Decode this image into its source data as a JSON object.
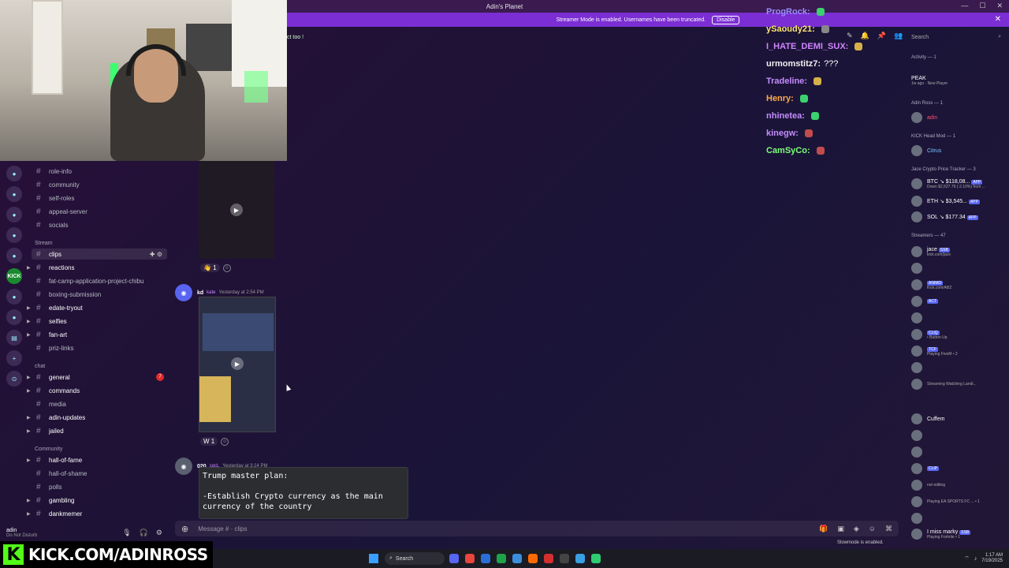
{
  "window": {
    "title": "Adin's Planet"
  },
  "banner": {
    "text": "Streamer Mode is enabled. Usernames have been truncated.",
    "button": "Disable"
  },
  "chat_topic": "ct too !",
  "channels": {
    "top_items": [
      "role-info",
      "community",
      "self-roles",
      "appeal-server",
      "socials"
    ],
    "stream_category": "Stream",
    "stream_items": [
      "clips",
      "reactions",
      "fat-camp-application-project-chibu",
      "boxing-submission",
      "edate-tryout",
      "selfies",
      "fan-art",
      "priz-links"
    ],
    "chat_category": "chat",
    "chat_items": [
      "general",
      "commands",
      "media",
      "adin-updates",
      "jailed"
    ],
    "general_badge": "7",
    "community_category": "Community",
    "community_items": [
      "hall-of-fame",
      "hall-of-shame",
      "polls",
      "gambling",
      "dankmemer"
    ]
  },
  "user": {
    "name": "adin",
    "status": "Do Not Disturb"
  },
  "kick": {
    "url": "KICK.COM/ADINROSS",
    "logo": "K"
  },
  "messages": [
    {
      "author": "kd",
      "tag": "kate",
      "time": "Yesterday at 2:54 PM"
    },
    {
      "author": "020",
      "tag": "sqcL",
      "time": "Yesterday at 3:24 PM"
    }
  ],
  "reactions": {
    "first": {
      "emoji": "👋",
      "count": "1"
    },
    "second": {
      "emoji": "W",
      "count": "1"
    }
  },
  "code": {
    "line1": "Trump master plan:",
    "line2": "",
    "line3": "-Establish Crypto currency as the main",
    "line4": "currency of the country"
  },
  "composer": {
    "placeholder": "Message # · clips"
  },
  "slowmode": "Slowmode is enabled.",
  "overlay": [
    {
      "name": "ProgRock:",
      "color": "#9b8cff",
      "msg": "",
      "emote": "#3bd16f"
    },
    {
      "name": "ySaoudy21:",
      "color": "#ffe27a",
      "msg": "",
      "emote": "#888"
    },
    {
      "name": "I_HATE_DEMI_SUX:",
      "color": "#d183ff",
      "msg": "",
      "emote": "#d6b14a"
    },
    {
      "name": "urmomstitz7:",
      "color": "#f0f0f0",
      "msg": "???",
      "emote": ""
    },
    {
      "name": "Tradeline:",
      "color": "#c48cff",
      "msg": "",
      "emote": "#d6b14a"
    },
    {
      "name": "Henry:",
      "color": "#ffa94d",
      "msg": "",
      "emote": "#3bd16f"
    },
    {
      "name": "nhinetea:",
      "color": "#c48cff",
      "msg": "",
      "emote": "#3bd16f"
    },
    {
      "name": "kinegw:",
      "color": "#c48cff",
      "msg": "",
      "emote": "#c14c4c"
    },
    {
      "name": "CamSyCo:",
      "color": "#7dff7a",
      "msg": "",
      "emote": "#c14c4c"
    }
  ],
  "search": {
    "placeholder": "Search"
  },
  "members": {
    "activity_head": "Activity — 1",
    "activity_item": {
      "title": "PEAK",
      "sub": "1w ago · New Player"
    },
    "adin_head": "Adin Ross — 1",
    "adin_member": "adin",
    "mod_head": "KICK Head Mod — 1",
    "mod_member": "Citrus",
    "crypto_head": "Jace Crypto Price Tracker — 3",
    "crypto": [
      {
        "name": "BTC ↘ $118,08...",
        "sub": "Down $2,527.79 (-2.10%) from ...",
        "pill": "APP"
      },
      {
        "name": "ETH ↘ $3,545...",
        "sub": "",
        "pill": "APP"
      },
      {
        "name": "SOL ↘ $177.34",
        "sub": "",
        "pill": "APP"
      }
    ],
    "streamers_head": "Streamers — 47",
    "streamers": [
      {
        "name": "jace",
        "sub": "kick.com/jace",
        "pill": "SSB"
      },
      {
        "name": "",
        "sub": "",
        "pill": ""
      },
      {
        "name": "",
        "sub": "Kick.com/ABZ",
        "pill": "ANIMO"
      },
      {
        "name": "",
        "sub": "",
        "pill": "ACT"
      },
      {
        "name": "",
        "sub": "",
        "pill": ""
      },
      {
        "name": "",
        "sub": "• Button Up.",
        "pill": "CLIQ"
      },
      {
        "name": "",
        "sub": "Playing FiveM • 2",
        "pill": "TCF"
      },
      {
        "name": "",
        "sub": "",
        "pill": ""
      },
      {
        "name": "",
        "sub": "Streaming Watching Landi...",
        "pill": ""
      },
      {
        "name": "Cuffem",
        "sub": "",
        "pill": ""
      },
      {
        "name": "",
        "sub": "",
        "pill": ""
      },
      {
        "name": "",
        "sub": "",
        "pill": ""
      },
      {
        "name": "",
        "sub": "",
        "pill": "CLIP"
      },
      {
        "name": "",
        "sub": "not editing",
        "pill": ""
      },
      {
        "name": "",
        "sub": "Playing EA SPORTS FC ... • 1",
        "pill": ""
      },
      {
        "name": "",
        "sub": "",
        "pill": ""
      },
      {
        "name": "I miss marky",
        "sub": "Playing Fortnite • 1",
        "pill": "SSB"
      }
    ]
  },
  "taskbar": {
    "search": "Search",
    "time": "1:17 AM",
    "date": "7/19/2025"
  }
}
